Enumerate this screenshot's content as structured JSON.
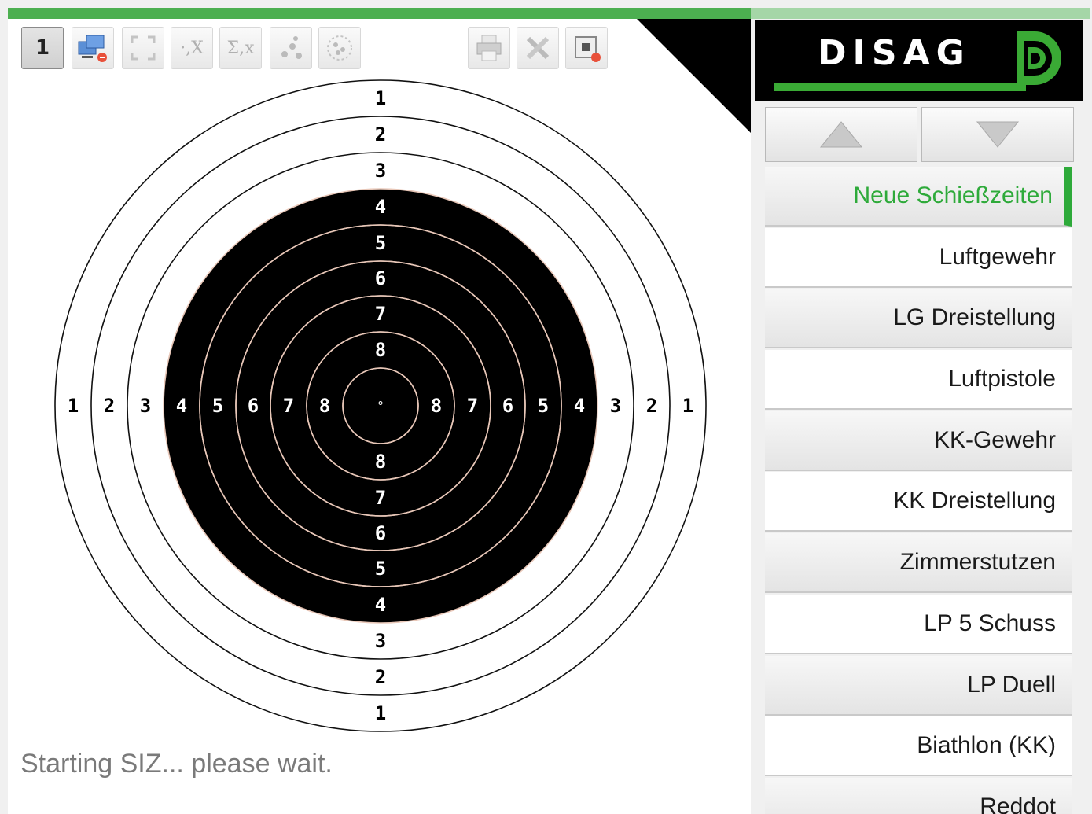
{
  "toolbar": {
    "target_number": "1",
    "icons": [
      "network-icon",
      "fullscreen-icon",
      "clear-x-icon",
      "sum-x-icon",
      "shot-group-icon",
      "scatter-icon",
      "printer-icon",
      "tools-icon",
      "stop-icon"
    ],
    "clear_x_label": "·,X",
    "sum_x_label": "Σ,x"
  },
  "target": {
    "top_numbers": [
      "1",
      "2",
      "3",
      "4",
      "5",
      "6",
      "7",
      "8"
    ],
    "bottom_numbers": [
      "8",
      "7",
      "6",
      "5",
      "4",
      "3",
      "2",
      "1"
    ],
    "left_numbers": [
      "1",
      "2",
      "3",
      "4",
      "5",
      "6",
      "7",
      "8"
    ],
    "right_numbers": [
      "8",
      "7",
      "6",
      "5",
      "4",
      "3",
      "2",
      "1"
    ],
    "center_mark": "°",
    "colors": {
      "black": "#000000",
      "white": "#ffffff",
      "ring_white_zone": "#111111",
      "ring_black_zone": "#e8c7b8"
    }
  },
  "status": {
    "text": "Starting SIZ... please wait."
  },
  "brand": {
    "name": "DISAG",
    "accent": "#3aaa35"
  },
  "nav": {
    "up_icon": "arrow-up-icon",
    "down_icon": "arrow-down-icon"
  },
  "menu": {
    "items": [
      {
        "label": "Neue Schießzeiten",
        "active": true
      },
      {
        "label": "Luftgewehr"
      },
      {
        "label": "LG Dreistellung"
      },
      {
        "label": "Luftpistole"
      },
      {
        "label": "KK-Gewehr"
      },
      {
        "label": "KK Dreistellung"
      },
      {
        "label": "Zimmerstutzen"
      },
      {
        "label": "LP 5 Schuss"
      },
      {
        "label": "LP Duell"
      },
      {
        "label": "Biathlon (KK)"
      },
      {
        "label": "Reddot"
      }
    ],
    "active_color": "#2eaa3a"
  }
}
